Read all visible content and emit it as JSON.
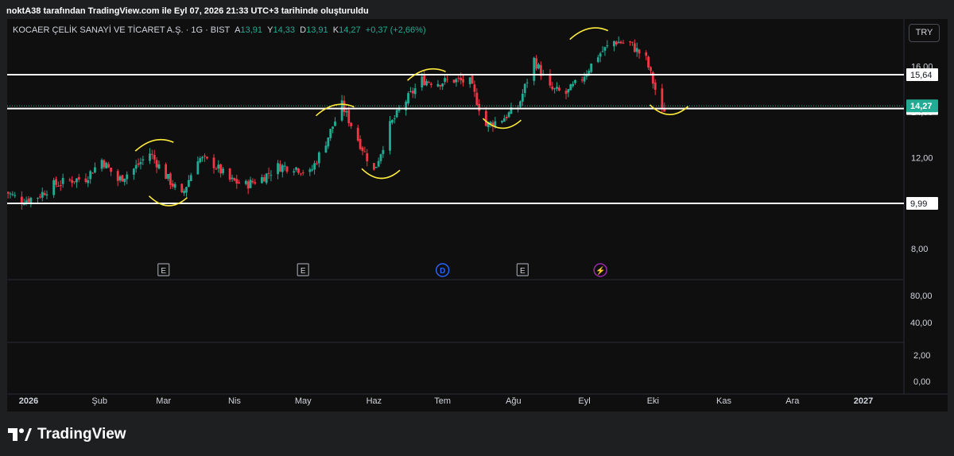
{
  "header": {
    "attribution": "noktA38 tarafından TradingView.com ile Eyl 07, 2026 21:33 UTC+3 tarihinde oluşturuldu"
  },
  "legend": {
    "symbol": "KOCAER ÇELİK SANAYİ VE TİCARET A.Ş. · 1G · BIST",
    "open_label": "A",
    "open_value": "13,91",
    "high_label": "Y",
    "high_value": "14,33",
    "low_label": "D",
    "low_value": "13,91",
    "close_label": "K",
    "close_value": "14,27",
    "change": "+0,37 (+2,66%)"
  },
  "currency_button": "TRY",
  "brand": {
    "name": "TradingView"
  },
  "colors": {
    "up": "#22ab94",
    "down": "#f23645",
    "panel_bg": "#0f0f0f",
    "page_bg": "#1e1f21",
    "drawing_line": "#ffffff",
    "highlight_curve": "#ffeb3b",
    "price_tag": "#22ab94"
  },
  "chart_data": {
    "type": "candlestick",
    "price_axis": {
      "ticks": [
        8,
        10,
        12,
        14,
        16
      ],
      "tick_labels": [
        "8,00",
        "10,00",
        "12,00",
        "14,00",
        "16,00"
      ],
      "range": [
        7.2,
        17.8
      ]
    },
    "indicator_axis_1": {
      "tick_labels": [
        "80,00",
        "40,00"
      ]
    },
    "indicator_axis_2": {
      "tick_labels": [
        "2,00",
        "0,00"
      ]
    },
    "time_axis": {
      "labels": [
        "2026",
        "Şub",
        "Mar",
        "Nis",
        "May",
        "Haz",
        "Tem",
        "Ağu",
        "Eyl",
        "Eki",
        "Kas",
        "Ara",
        "2027"
      ],
      "dates": [
        "2026-01-01",
        "2026-02-01",
        "2026-03-01",
        "2026-04-01",
        "2026-05-01",
        "2026-06-01",
        "2026-07-01",
        "2026-08-01",
        "2026-09-01",
        "2026-10-01",
        "2026-11-01",
        "2026-12-01",
        "2027-01-01"
      ]
    },
    "horizontal_lines": [
      {
        "price": 15.64,
        "label": "15,64"
      },
      {
        "price": 14.15,
        "label": "14,15"
      },
      {
        "price": 9.99,
        "label": "9,99"
      }
    ],
    "last_price": {
      "price": 14.27,
      "label": "14,27"
    },
    "events": [
      {
        "label": "E",
        "date": "2026-03-01"
      },
      {
        "label": "E",
        "date": "2026-05-01"
      },
      {
        "label": "D",
        "date": "2026-07-01"
      },
      {
        "label": "E",
        "date": "2026-08-05"
      },
      {
        "label": "⚡",
        "date": "2026-09-08"
      }
    ],
    "close_path": [
      [
        "2025-12-22",
        10.5
      ],
      [
        "2025-12-29",
        10.1
      ],
      [
        "2026-01-05",
        10.3
      ],
      [
        "2026-01-12",
        10.8
      ],
      [
        "2026-01-19",
        11.0
      ],
      [
        "2026-01-26",
        11.1
      ],
      [
        "2026-02-02",
        11.9
      ],
      [
        "2026-02-09",
        11.0
      ],
      [
        "2026-02-16",
        11.5
      ],
      [
        "2026-02-23",
        12.2
      ],
      [
        "2026-03-02",
        11.2
      ],
      [
        "2026-03-09",
        10.3
      ],
      [
        "2026-03-16",
        12.0
      ],
      [
        "2026-03-23",
        11.7
      ],
      [
        "2026-03-30",
        11.0
      ],
      [
        "2026-04-06",
        10.8
      ],
      [
        "2026-04-13",
        11.1
      ],
      [
        "2026-04-20",
        11.6
      ],
      [
        "2026-04-27",
        11.6
      ],
      [
        "2026-05-04",
        11.3
      ],
      [
        "2026-05-11",
        12.7
      ],
      [
        "2026-05-18",
        14.3
      ],
      [
        "2026-05-25",
        12.8
      ],
      [
        "2026-06-01",
        11.4
      ],
      [
        "2026-06-08",
        13.4
      ],
      [
        "2026-06-15",
        14.5
      ],
      [
        "2026-06-22",
        15.4
      ],
      [
        "2026-06-29",
        15.3
      ],
      [
        "2026-07-06",
        15.4
      ],
      [
        "2026-07-13",
        15.3
      ],
      [
        "2026-07-20",
        13.4
      ],
      [
        "2026-07-27",
        13.7
      ],
      [
        "2026-08-03",
        14.2
      ],
      [
        "2026-08-10",
        16.3
      ],
      [
        "2026-08-17",
        15.0
      ],
      [
        "2026-08-24",
        14.8
      ],
      [
        "2026-08-31",
        15.5
      ],
      [
        "2026-09-07",
        16.5
      ],
      [
        "2026-09-14",
        17.1
      ],
      [
        "2026-09-21",
        17.0
      ],
      [
        "2026-09-28",
        16.3
      ],
      [
        "2026-10-05",
        14.0
      ],
      [
        "2026-10-07",
        14.27
      ]
    ],
    "annotations": [
      {
        "type": "curve",
        "center_date": "2026-02-25",
        "price": 12.6
      },
      {
        "type": "curve",
        "center_date": "2026-03-03",
        "price": 10.0
      },
      {
        "type": "curve",
        "center_date": "2026-05-15",
        "price": 14.15
      },
      {
        "type": "curve",
        "center_date": "2026-06-04",
        "price": 11.2
      },
      {
        "type": "curve",
        "center_date": "2026-06-24",
        "price": 15.7
      },
      {
        "type": "curve",
        "center_date": "2026-07-27",
        "price": 13.4
      },
      {
        "type": "curve",
        "center_date": "2026-09-03",
        "price": 17.5
      },
      {
        "type": "curve",
        "center_date": "2026-10-08",
        "price": 14.0
      }
    ]
  }
}
